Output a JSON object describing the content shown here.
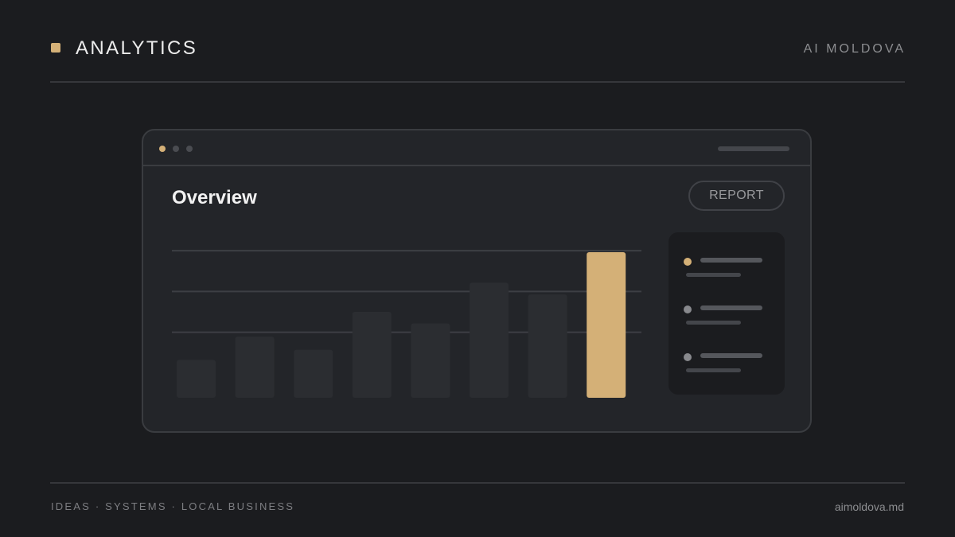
{
  "header": {
    "title": "ANALYTICS",
    "brand": "AI MOLDOVA",
    "accent_color": "#d4b077"
  },
  "window": {
    "title_dots": [
      "#d4b077",
      "#4a4c51",
      "#4a4c51"
    ],
    "heading": "Overview",
    "report_button": "REPORT",
    "legend": {
      "items": [
        {
          "dot_color": "#d4b077"
        },
        {
          "dot_color": "#88898d"
        },
        {
          "dot_color": "#88898d"
        }
      ]
    }
  },
  "chart_data": {
    "type": "bar",
    "values": [
      26,
      42,
      33,
      59,
      51,
      79,
      71,
      100
    ],
    "ylim": [
      0,
      100
    ],
    "gridlines": [
      45,
      73,
      101
    ],
    "highlight_index": 7,
    "bar_color": "#2b2d31",
    "highlight_color": "#d4b077",
    "grid_color": "#3d3f44"
  },
  "footer": {
    "tagline": "IDEAS · SYSTEMS · LOCAL BUSINESS",
    "site": "aimoldova.md"
  }
}
